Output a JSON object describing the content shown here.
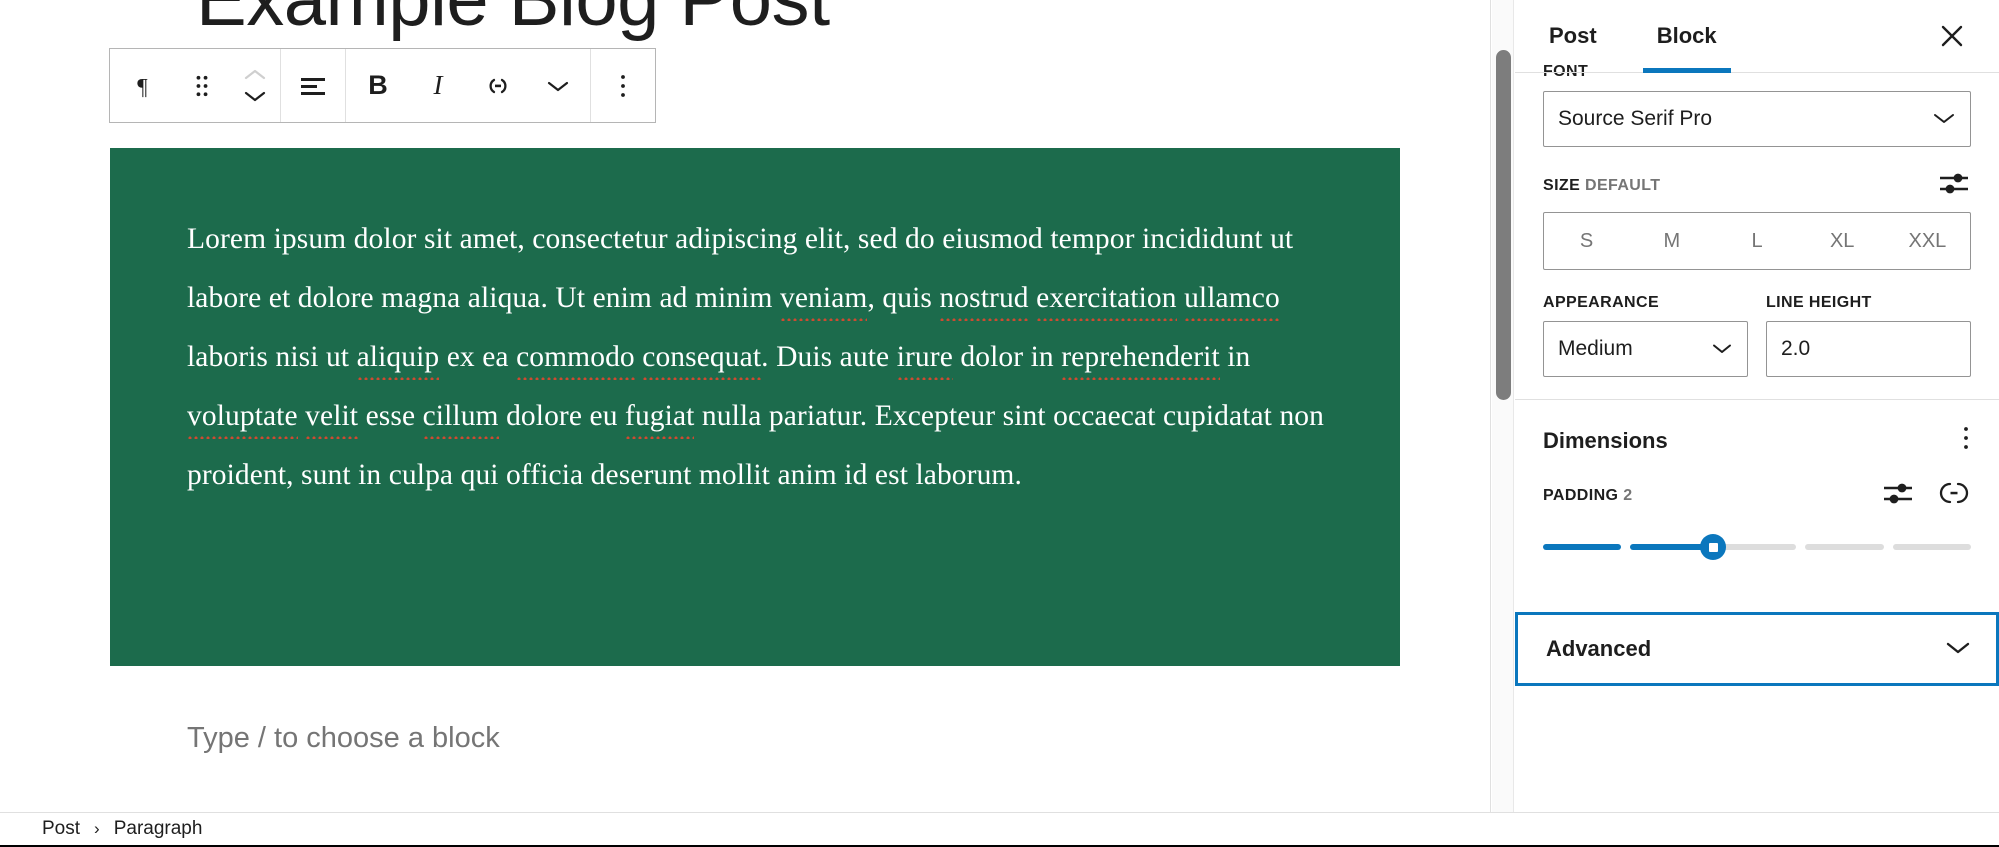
{
  "editor": {
    "post_title": "Example Blog Post",
    "empty_paragraph_placeholder": "Type / to choose a block",
    "paragraph": {
      "background_color": "#1c6b4c",
      "text_color": "#ffffff",
      "segments": [
        {
          "text": "Lorem ipsum dolor sit amet, consectetur adipiscing elit, sed do eiusmod tempor incididunt ut labore et dolore magna aliqua. Ut enim ad minim ",
          "spellcheck": false
        },
        {
          "text": "veniam",
          "spellcheck": true
        },
        {
          "text": ", quis ",
          "spellcheck": false
        },
        {
          "text": "nostrud",
          "spellcheck": true
        },
        {
          "text": " ",
          "spellcheck": false
        },
        {
          "text": "exercitation",
          "spellcheck": true
        },
        {
          "text": " ",
          "spellcheck": false
        },
        {
          "text": "ullamco",
          "spellcheck": true
        },
        {
          "text": " laboris nisi ut ",
          "spellcheck": false
        },
        {
          "text": "aliquip",
          "spellcheck": true
        },
        {
          "text": " ex ea ",
          "spellcheck": false
        },
        {
          "text": "commodo",
          "spellcheck": true
        },
        {
          "text": " ",
          "spellcheck": false
        },
        {
          "text": "consequat",
          "spellcheck": true
        },
        {
          "text": ". Duis aute ",
          "spellcheck": false
        },
        {
          "text": "irure",
          "spellcheck": true
        },
        {
          "text": " dolor in ",
          "spellcheck": false
        },
        {
          "text": "reprehenderit",
          "spellcheck": true
        },
        {
          "text": " in ",
          "spellcheck": false
        },
        {
          "text": "voluptate",
          "spellcheck": true
        },
        {
          "text": " ",
          "spellcheck": false
        },
        {
          "text": "velit",
          "spellcheck": true
        },
        {
          "text": " esse ",
          "spellcheck": false
        },
        {
          "text": "cillum",
          "spellcheck": true
        },
        {
          "text": " dolore eu ",
          "spellcheck": false
        },
        {
          "text": "fugiat",
          "spellcheck": true
        },
        {
          "text": " nulla pariatur. Excepteur sint occaecat cupidatat non proident, sunt in culpa qui officia deserunt mollit anim id est laborum.",
          "spellcheck": false
        }
      ]
    }
  },
  "block_toolbar": {
    "block_type_icon": "paragraph-icon",
    "drag_handle_icon": "drag-handle-icon",
    "move_up_icon": "chevron-up-icon",
    "move_down_icon": "chevron-down-icon",
    "align_icon": "align-text-icon",
    "bold_label": "B",
    "italic_label": "I",
    "link_icon": "link-icon",
    "more_formatting_icon": "chevron-down-icon",
    "options_icon": "more-vertical-icon"
  },
  "breadcrumb": {
    "items": [
      "Post",
      "Paragraph"
    ],
    "separator": "›"
  },
  "sidebar": {
    "tabs": [
      {
        "label": "Post",
        "active": false
      },
      {
        "label": "Block",
        "active": true
      }
    ],
    "close_icon": "close-icon",
    "accent_color": "#0b77bd",
    "typography": {
      "font_label": "FONT",
      "font_value": "Source Serif Pro",
      "size_label": "SIZE",
      "size_value_label": "DEFAULT",
      "size_settings_icon": "settings-sliders-icon",
      "size_options": [
        "S",
        "M",
        "L",
        "XL",
        "XXL"
      ],
      "appearance_label": "APPEARANCE",
      "appearance_value": "Medium",
      "line_height_label": "LINE HEIGHT",
      "line_height_value": "2.0"
    },
    "dimensions": {
      "title": "Dimensions",
      "options_icon": "more-vertical-icon",
      "padding_label": "PADDING",
      "padding_value": "2",
      "padding_settings_icon": "settings-sliders-icon",
      "padding_link_icon": "link-sides-icon",
      "slider_segments": 5,
      "slider_filled": 2
    },
    "advanced": {
      "label": "Advanced",
      "chevron_icon": "chevron-down-icon",
      "focused": true
    }
  }
}
